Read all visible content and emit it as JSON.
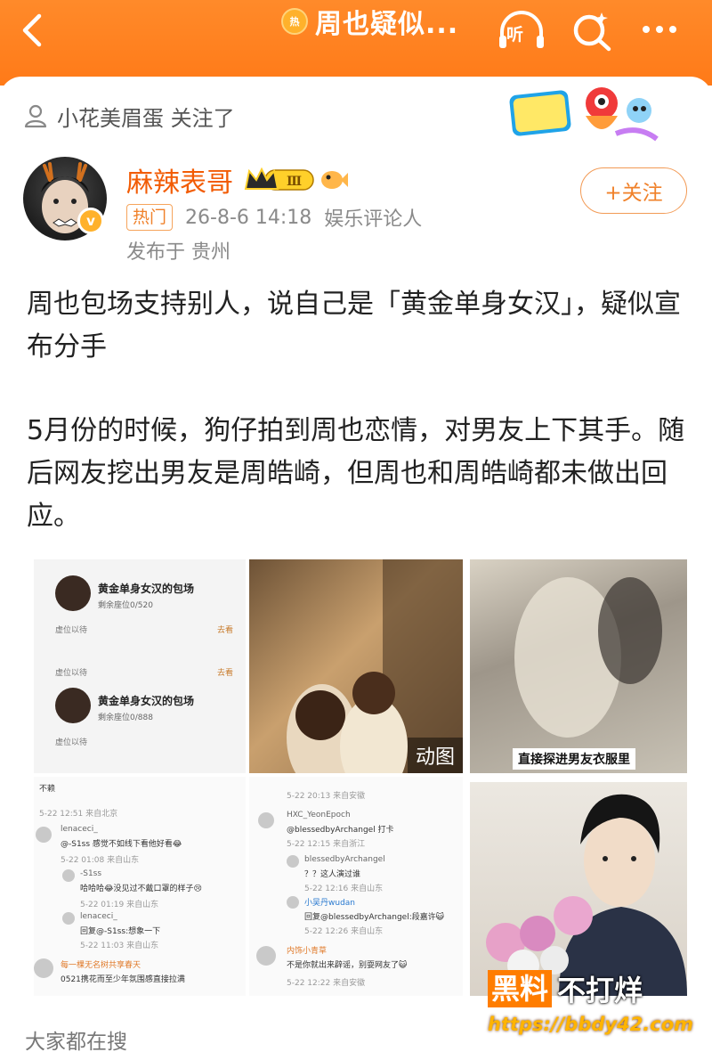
{
  "topbar": {
    "title": "周也疑似...",
    "hot_badge": "热",
    "listen_label": "听",
    "background_color": "#ff7a18"
  },
  "followed_notice": {
    "text": "小花美眉蛋 关注了"
  },
  "author": {
    "name": "麻辣表哥",
    "level_badge": "Ⅲ",
    "verify_mark": "v",
    "hot_tag": "热门",
    "datetime": "26-8-6 14:18",
    "role": "娱乐评论人",
    "location": "发布于 贵州",
    "follow_button": "+关注"
  },
  "post": {
    "paragraph1": "周也包场支持别人，说自己是「黄金单身女汉」，疑似宣布分手",
    "paragraph2": "5月份的时候，狗仔拍到周也恋情，对男友上下其手。随后网友挖出男友是周皓崎，但周也和周皓崎都未做出回应。"
  },
  "images": {
    "img1": {
      "card1_title": "黄金单身女汉的包场",
      "card1_sub": "剩余座位0/520",
      "card1_foot": "虚位以待",
      "card1_btn": "去看",
      "card2_top": "虚位以待",
      "card2_title": "黄金单身女汉的包场",
      "card2_sub": "剩余座位0/888",
      "card2_foot": "虚位以待",
      "card2_btn": "去看"
    },
    "img2": {
      "gif_label": "动图"
    },
    "img3": {
      "caption": "直接探进男友衣服里"
    },
    "img4": {
      "top_text": "不赖",
      "time1": "5-22 12:51 来自北京",
      "c1_user": "lenaceci_",
      "c1_text": "@-S1ss 感觉不如线下看他好看😂",
      "c1_time": "5-22 01:08 来自山东",
      "c2_user": "-S1ss",
      "c2_text": "哈哈哈😂没见过不戴口罩的样子😢",
      "c2_time": "5-22 01:19 来自山东",
      "c3_user": "lenaceci_",
      "c3_text": "回复@-S1ss:想象一下",
      "c3_time": "5-22 11:03 来自山东",
      "c4_user": "每一棵无名树共享春天",
      "c4_text": "0521携花而至少年氛围感直接拉满"
    },
    "img5": {
      "time0": "5-22 20:13 来自安徽",
      "c1_user": "HXC_YeonEpoch",
      "c1_text": "@blessedbyArchangel 打卡",
      "c1_time": "5-22 12:15 来自浙江",
      "c2_user": "blessedbyArchangel",
      "c2_text": "？？这人演过谁",
      "c2_time": "5-22 12:16 来自山东",
      "c3_user": "小吴丹wudan",
      "c3_text": "回复@blessedbyArchangel:段嘉许😺",
      "c3_time": "5-22 12:26 来自山东",
      "c4_user": "内饰小青草",
      "c4_text": "不是你就出来辟谣，别耍网友了😺",
      "c4_time": "5-22 12:22 来自安徽"
    }
  },
  "footer": {
    "search_title": "大家都在搜"
  },
  "watermark": {
    "box": "黑料",
    "rest": "不打烊",
    "url": "https://bbdy42.com"
  }
}
